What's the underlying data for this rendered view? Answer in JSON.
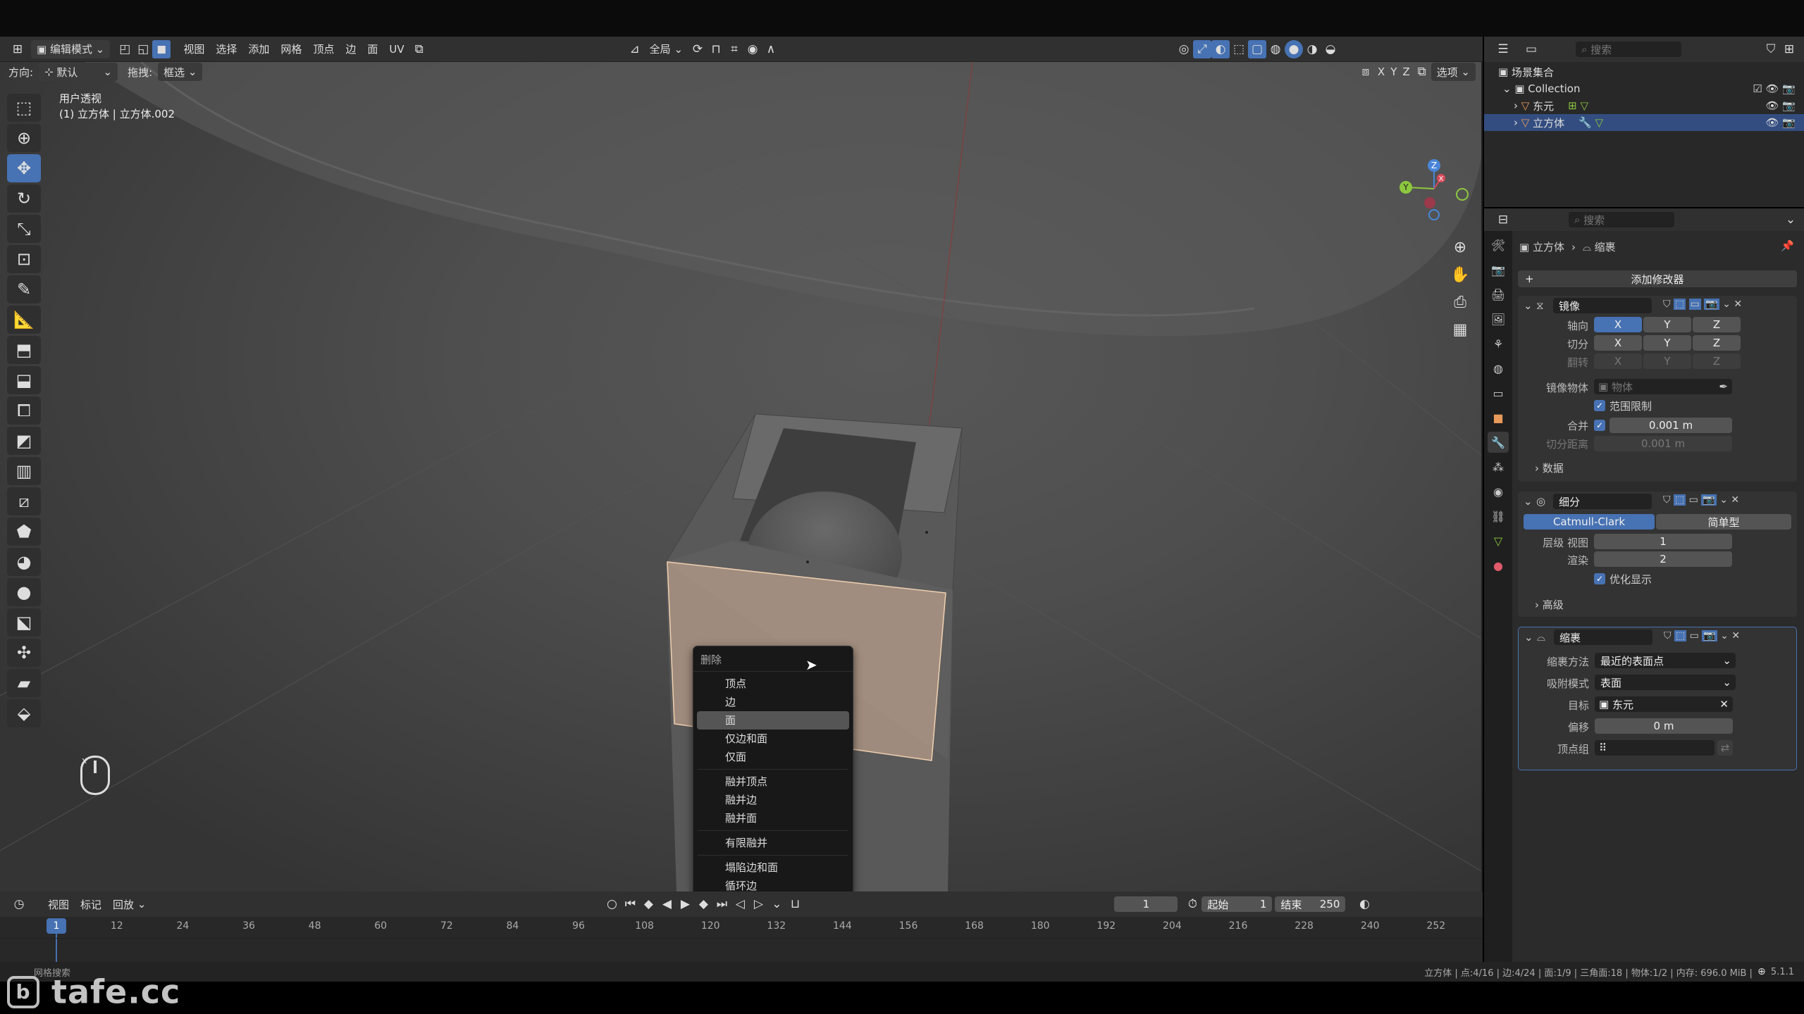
{
  "header": {
    "mode": "编辑模式",
    "menus": [
      "视图",
      "选择",
      "添加",
      "网格",
      "顶点",
      "边",
      "面",
      "UV"
    ],
    "transform_orientation": "全局",
    "axes": [
      "X",
      "Y",
      "Z"
    ],
    "options": "选项"
  },
  "subheader": {
    "orientation_label": "方向:",
    "orientation_value": "默认",
    "drag_label": "拖拽:",
    "drag_value": "框选"
  },
  "viewport": {
    "view_name": "用户透视",
    "object_info": "(1) 立方体 | 立方体.002",
    "gizmo_axes": [
      "X",
      "Y",
      "Z"
    ]
  },
  "context_menu": {
    "title": "删除",
    "groups": [
      [
        "顶点",
        "边",
        "面",
        "仅边和面",
        "仅面"
      ],
      [
        "融并顶点",
        "融并边",
        "融并面"
      ],
      [
        "有限融并"
      ],
      [
        "塌陷边和面",
        "循环边"
      ]
    ],
    "highlighted": "面"
  },
  "timeline": {
    "menus": [
      "视图",
      "标记",
      "回放"
    ],
    "current_frame": "1",
    "start_label": "起始",
    "start": "1",
    "end_label": "结束",
    "end": "250",
    "ticks": [
      "1",
      "12",
      "24",
      "36",
      "48",
      "60",
      "72",
      "84",
      "96",
      "108",
      "120",
      "132",
      "144",
      "156",
      "168",
      "180",
      "192",
      "204",
      "216",
      "228",
      "240",
      "252"
    ]
  },
  "status": {
    "left": "网格搜索",
    "info": "立方体 | 点:4/16 | 边:4/24 | 面:1/9 | 三角面:18 | 物体:1/2 | 内存: 696.0 MiB | ",
    "version": "5.1.1"
  },
  "outliner": {
    "search_placeholder": "搜索",
    "scene_collection": "场景集合",
    "collection": "Collection",
    "objects": [
      "东元",
      "立方体"
    ],
    "selected": "立方体"
  },
  "properties": {
    "search_placeholder": "搜索",
    "breadcrumb_object": "立方体",
    "breadcrumb_modifier": "缩裹",
    "add_modifier": "添加修改器",
    "mirror": {
      "name": "镜像",
      "axis_label": "轴向",
      "bisect_label": "切分",
      "flip_label": "翻转",
      "axes": [
        "X",
        "Y",
        "Z"
      ],
      "mirror_object_label": "镜像物体",
      "mirror_object_placeholder": "物体",
      "clipping_label": "范围限制",
      "merge_label": "合并",
      "merge_value": "0.001 m",
      "bisect_distance_label": "切分距离",
      "bisect_distance_value": "0.001 m",
      "data_label": "数据"
    },
    "subdivision": {
      "name": "细分",
      "mode_a": "Catmull-Clark",
      "mode_b": "简单型",
      "levels_label": "层级 视图",
      "levels_value": "1",
      "render_label": "渲染",
      "render_value": "2",
      "optimal_label": "优化显示",
      "advanced_label": "高级"
    },
    "shrinkwrap": {
      "name": "缩裹",
      "method_label": "缩裹方法",
      "method_value": "最近的表面点",
      "snap_label": "吸附模式",
      "snap_value": "表面",
      "target_label": "目标",
      "target_value": "东元",
      "offset_label": "偏移",
      "offset_value": "0 m",
      "vgroup_label": "顶点组"
    }
  },
  "watermark": "tafe.cc",
  "colors": {
    "accent": "#4772b3",
    "selection": "#e0b89a",
    "bg": "#303030"
  }
}
